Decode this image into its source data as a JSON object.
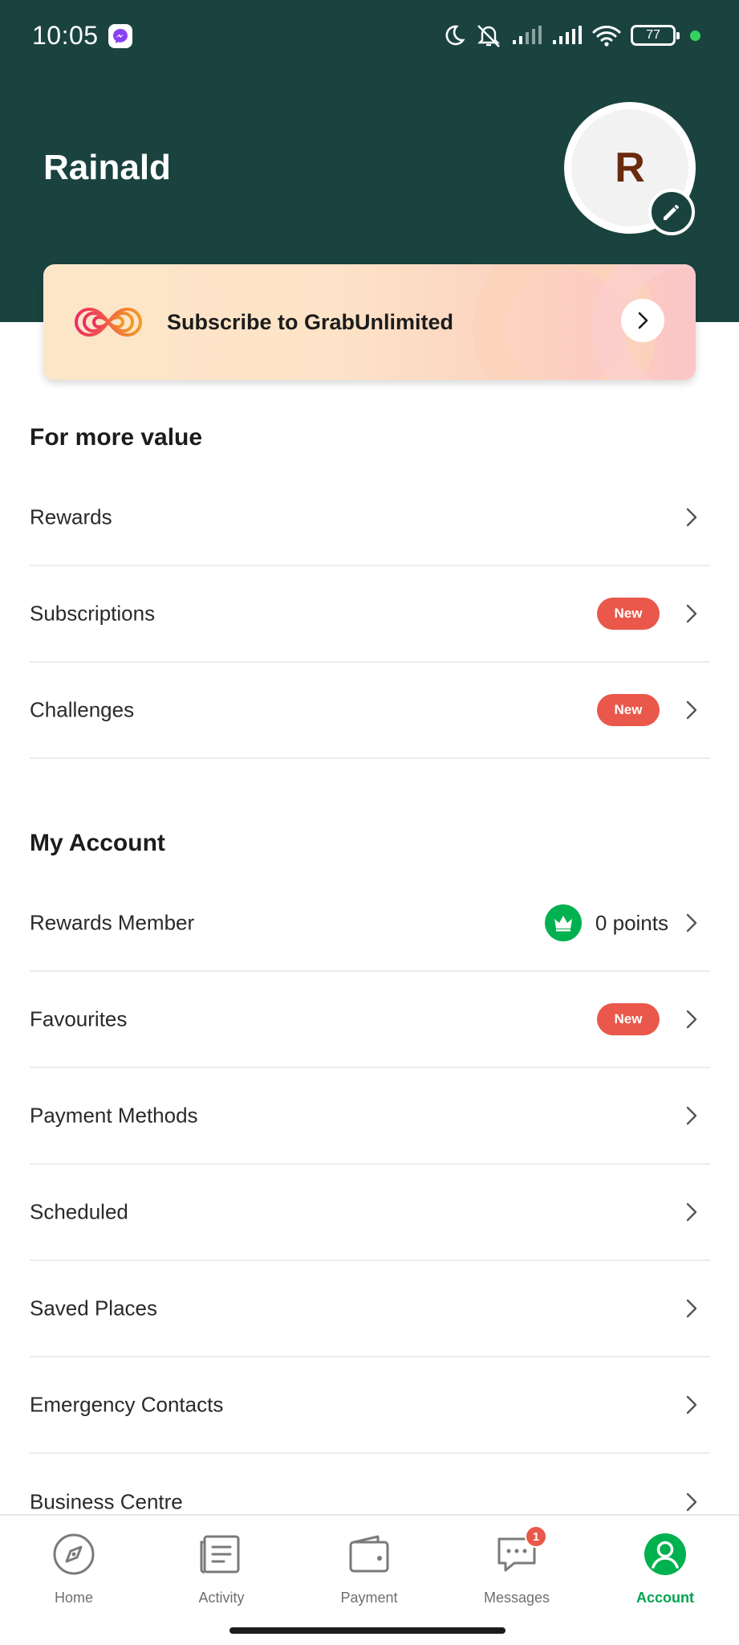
{
  "status_bar": {
    "time": "10:05",
    "battery": "77",
    "icons": [
      "moon-icon",
      "bell-off-icon",
      "signal-icon",
      "signal-icon",
      "wifi-icon",
      "battery-icon"
    ]
  },
  "profile": {
    "name": "Rainald",
    "avatar_initial": "R"
  },
  "banner": {
    "text": "Subscribe to GrabUnlimited"
  },
  "sections": {
    "more_value": {
      "title": "For more value",
      "items": [
        {
          "label": "Rewards"
        },
        {
          "label": "Subscriptions",
          "badge": "New"
        },
        {
          "label": "Challenges",
          "badge": "New"
        }
      ]
    },
    "my_account": {
      "title": "My Account",
      "items": [
        {
          "label": "Rewards Member",
          "points": "0 points"
        },
        {
          "label": "Favourites",
          "badge": "New"
        },
        {
          "label": "Payment Methods"
        },
        {
          "label": "Scheduled"
        },
        {
          "label": "Saved Places"
        },
        {
          "label": "Emergency Contacts"
        },
        {
          "label": "Business Centre"
        }
      ]
    }
  },
  "bottom_nav": {
    "items": [
      {
        "label": "Home",
        "icon": "compass-icon"
      },
      {
        "label": "Activity",
        "icon": "receipt-icon"
      },
      {
        "label": "Payment",
        "icon": "wallet-icon"
      },
      {
        "label": "Messages",
        "icon": "chat-icon",
        "badge": "1"
      },
      {
        "label": "Account",
        "icon": "account-icon",
        "active": true
      }
    ]
  },
  "colors": {
    "header_bg": "#1a4340",
    "accent_green": "#00b14f",
    "badge_red": "#e9584a"
  }
}
